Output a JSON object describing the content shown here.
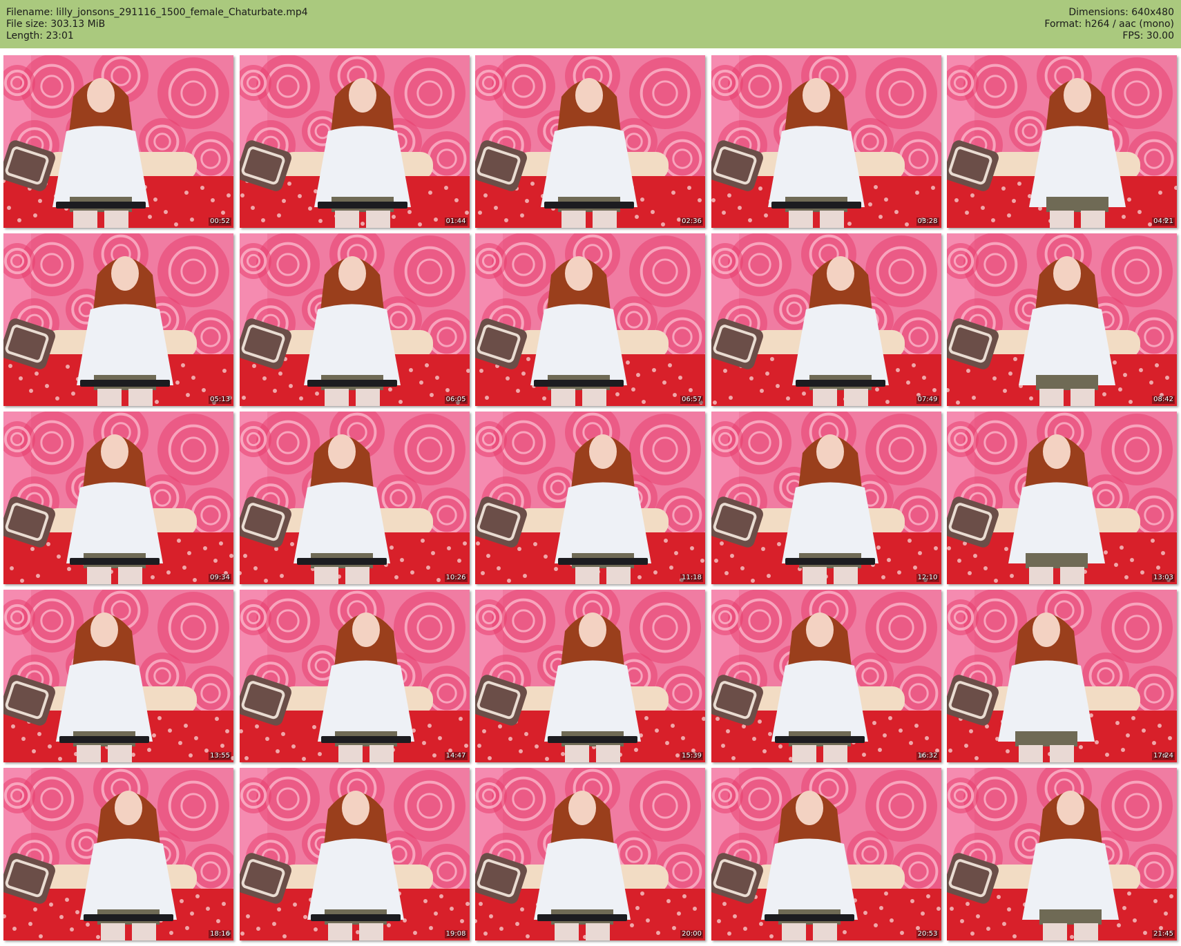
{
  "header": {
    "filename_line": "Filename: lilly_jonsons_291116_1500_female_Chaturbate.mp4",
    "filesize_line": "File size: 303.13 MiB",
    "length_line": "Length: 23:01",
    "dimensions_line": "Dimensions: 640x480",
    "format_line": "Format: h264 / aac (mono)",
    "fps_line": "FPS: 30.00",
    "background_color": "#aac97e"
  },
  "thumbnails": [
    {
      "timestamp": "00:52"
    },
    {
      "timestamp": "01:44"
    },
    {
      "timestamp": "02:36"
    },
    {
      "timestamp": "03:28"
    },
    {
      "timestamp": "04:21"
    },
    {
      "timestamp": "05:13"
    },
    {
      "timestamp": "06:05"
    },
    {
      "timestamp": "06:57"
    },
    {
      "timestamp": "07:49"
    },
    {
      "timestamp": "08:42"
    },
    {
      "timestamp": "09:34"
    },
    {
      "timestamp": "10:26"
    },
    {
      "timestamp": "11:18"
    },
    {
      "timestamp": "12:10"
    },
    {
      "timestamp": "13:03"
    },
    {
      "timestamp": "13:55"
    },
    {
      "timestamp": "14:47"
    },
    {
      "timestamp": "15:39"
    },
    {
      "timestamp": "16:32"
    },
    {
      "timestamp": "17:24"
    },
    {
      "timestamp": "18:16"
    },
    {
      "timestamp": "19:08"
    },
    {
      "timestamp": "20:00"
    },
    {
      "timestamp": "20:53"
    },
    {
      "timestamp": "21:45"
    }
  ],
  "scene_colors": {
    "wall_pink": "#f07ca2",
    "rose_pink": "#e8406f",
    "bedspread_red": "#d8202a",
    "headboard_cream": "#f2dcc4",
    "blouse_white": "#eef1f6",
    "hair_auburn": "#9a3f1c",
    "skin": "#f3d2c2",
    "keyboard_black": "#1c1c20"
  }
}
